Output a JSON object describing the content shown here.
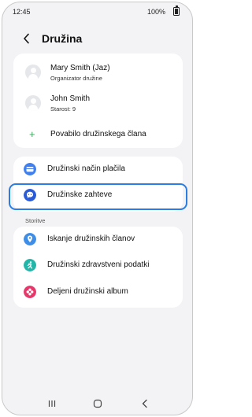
{
  "status_bar": {
    "time": "12:45",
    "battery": "100%"
  },
  "header": {
    "title": "Družina"
  },
  "members": [
    {
      "name": "Mary Smith (Jaz)",
      "subtitle": "Organizator družine"
    },
    {
      "name": "John Smith",
      "subtitle": "Starost: 9"
    }
  ],
  "invite": {
    "label": "Povabilo družinskega člana"
  },
  "settings": [
    {
      "label": "Družinski način plačila",
      "icon": "payment-card-icon",
      "color": "#3f7ff0"
    },
    {
      "label": "Družinske zahteve",
      "icon": "chat-request-icon",
      "color": "#2a5bd7"
    }
  ],
  "services_section": {
    "title": "Storitve"
  },
  "services": [
    {
      "label": "Iskanje družinskih članov",
      "icon": "location-pin-icon",
      "color": "#3e8ee8"
    },
    {
      "label": "Družinski zdravstveni podatki",
      "icon": "health-icon",
      "color": "#23b5a8"
    },
    {
      "label": "Deljeni družinski album",
      "icon": "flower-album-icon",
      "color": "#e6386b"
    }
  ],
  "highlight_color": "#2a7de1",
  "nav_bar": {
    "buttons": [
      "recents-icon",
      "home-icon",
      "back-nav-icon"
    ]
  }
}
